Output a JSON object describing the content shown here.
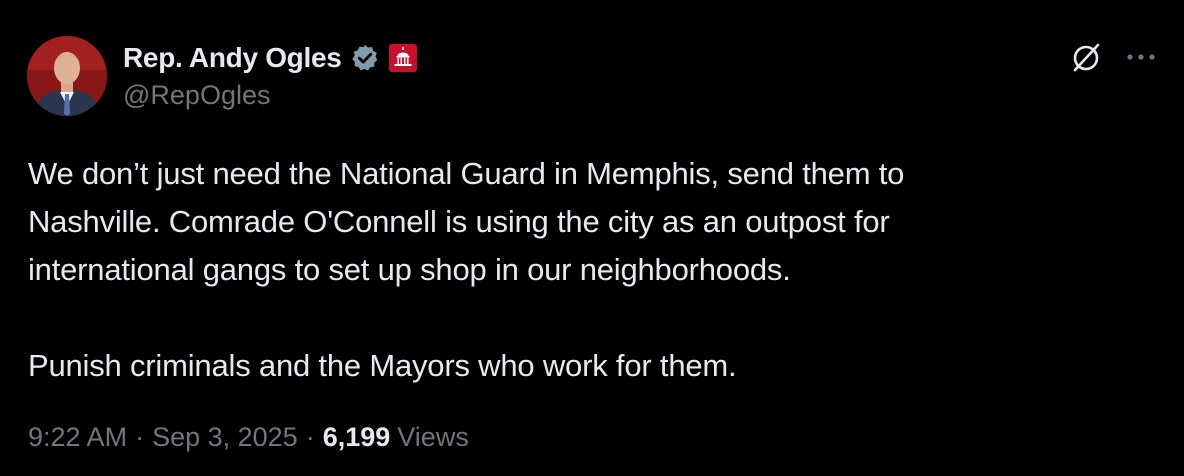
{
  "author": {
    "display_name": "Rep. Andy Ogles",
    "handle": "@RepOgles",
    "verified_badge_icon": "verified-badge-icon",
    "verified_badge_color": "#829aab",
    "affiliation_icon": "capitol-affiliation-icon",
    "affiliation_color": "#c8102e"
  },
  "tweet": {
    "paragraphs": [
      "We don’t just need the National Guard in Memphis, send them to",
      "Nashville. Comrade O'Connell is using the city as an outpost for",
      "international gangs to set up shop in our neighborhoods.",
      "Punish criminals and the Mayors who work for them."
    ],
    "time": "9:22 AM",
    "date": "Sep 3, 2025",
    "separator": "·",
    "views_count": "6,199",
    "views_label": "Views"
  },
  "actions": {
    "grok_icon": "grok-icon",
    "more_icon": "more-icon"
  },
  "colors": {
    "background": "#000000",
    "text_primary": "#e7e9ea",
    "text_secondary": "#71767b"
  }
}
